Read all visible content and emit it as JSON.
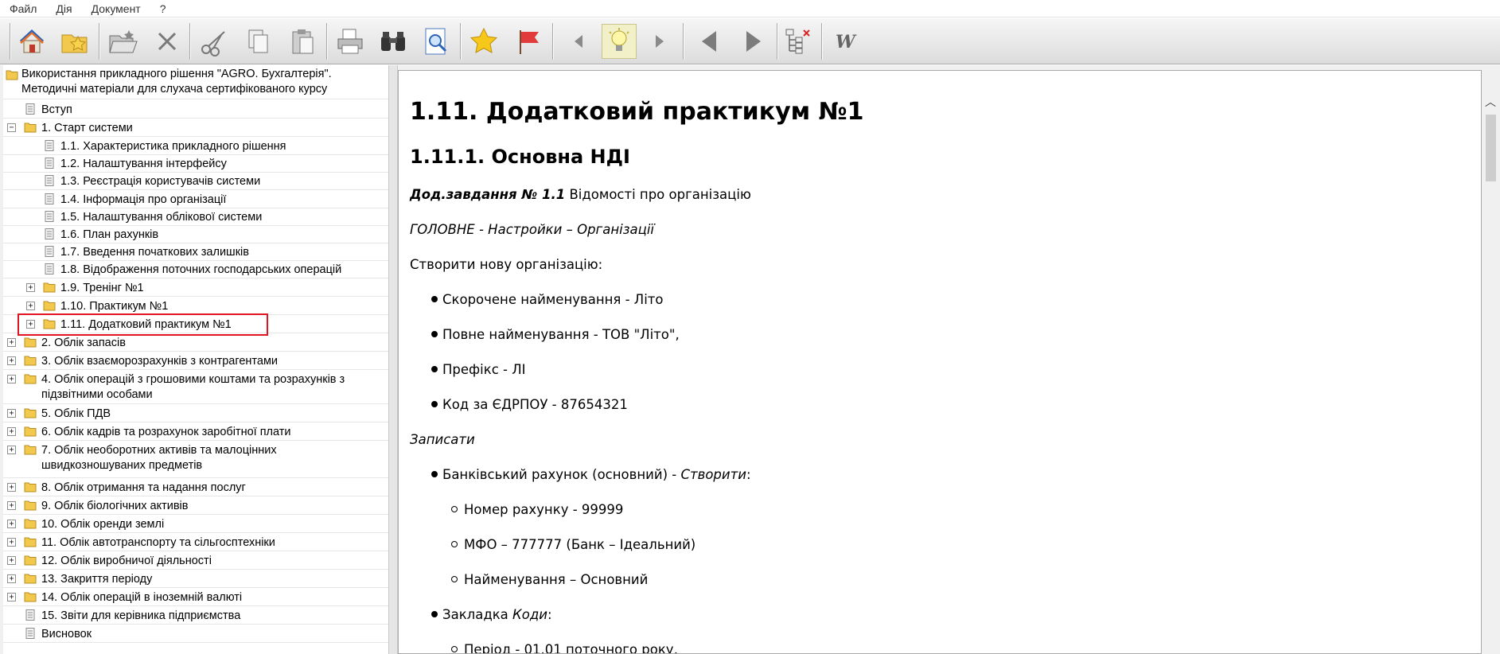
{
  "menu": [
    "Файл",
    "Дія",
    "Документ",
    "?"
  ],
  "toolbar": {
    "buttons": [
      "home-icon",
      "favorites-folder-icon",
      "open-folder-icon",
      "delete-icon",
      "cut-icon",
      "copy-icon",
      "paste-icon",
      "print-icon",
      "find-icon",
      "preview-icon",
      "star-icon",
      "flag-icon",
      "back-small-icon",
      "bulb-icon",
      "forward-small-icon",
      "back-icon",
      "forward-icon",
      "tree-sync-icon",
      "word-export-icon"
    ]
  },
  "tree": {
    "root": "Використання прикладного рішення \"AGRO. Бухгалтерія\". Методичні матеріали для слухача сертифікованого курсу",
    "items": [
      {
        "label": "Вступ"
      },
      {
        "label": "1. Старт системи"
      },
      {
        "label": "1.1. Характеристика прикладного рішення"
      },
      {
        "label": "1.2. Налаштування інтерфейсу"
      },
      {
        "label": "1.3. Реєстрація користувачів системи"
      },
      {
        "label": "1.4. Інформація про організації"
      },
      {
        "label": "1.5. Налаштування облікової системи"
      },
      {
        "label": "1.6. План рахунків"
      },
      {
        "label": "1.7. Введення початкових залишків"
      },
      {
        "label": "1.8. Відображення поточних господарських операцій"
      },
      {
        "label": "1.9. Тренінг №1"
      },
      {
        "label": "1.10. Практикум №1"
      },
      {
        "label": "1.11. Додатковий практикум №1"
      },
      {
        "label": "2. Облік запасів"
      },
      {
        "label": "3. Облік взаєморозрахунків з контрагентами"
      },
      {
        "label": "4. Облік операцій з грошовими коштами та розрахунків з підзвітними особами"
      },
      {
        "label": "5. Облік ПДВ"
      },
      {
        "label": "6. Облік кадрів та розрахунок заробітної плати"
      },
      {
        "label": "7. Облік необоротних активів та малоцінних швидкозношуваних предметів"
      },
      {
        "label": "8. Облік отримання та надання послуг"
      },
      {
        "label": "9. Облік біологічних активів"
      },
      {
        "label": "10. Облік оренди землі"
      },
      {
        "label": "11. Облік автотранспорту та сільгосптехніки"
      },
      {
        "label": "12. Облік виробничої діяльності"
      },
      {
        "label": "13. Закриття періоду"
      },
      {
        "label": "14. Облік операцій в іноземній валюті"
      },
      {
        "label": "15. Звіти для керівника підприємства"
      },
      {
        "label": "Висновок"
      }
    ]
  },
  "doc": {
    "h1": "1.11. Додатковий практикум №1",
    "h2": "1.11.1. Основна НДІ",
    "task_bold": "Дод.завдання № 1.1",
    "task_rest": " Відомості про організацію",
    "path": "ГОЛОВНЕ - Настройки – Організації",
    "create": "Створити нову організацію:",
    "b1": "Скорочене найменування - Літо",
    "b2": "Повне найменування - ТОВ \"Літо\",",
    "b3": "Префікс - ЛІ",
    "b4": "Код за ЄДРПОУ - 87654321",
    "save": "Записати",
    "b5_pre": "Банківський рахунок (основний) - ",
    "b5_it": "Створити",
    "b5_post": ":",
    "s1": "Номер рахунку - 99999",
    "s2": "МФО – 777777 (Банк – Ідеальний)",
    "s3": "Найменування – Основний",
    "b6_pre": "Закладка ",
    "b6_it": "Коди",
    "b6_post": ":",
    "s4": "Період - 01.01 поточного року,"
  }
}
